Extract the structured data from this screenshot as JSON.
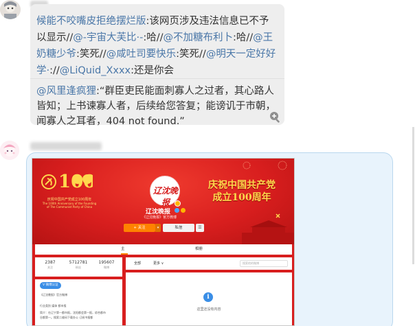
{
  "post1": {
    "repost": [
      {
        "t": "候能不咬嘴皮拒绝摆烂版",
        "m": true
      },
      {
        "t": ":该网页涉及违法信息已不予以显示//",
        "m": false
      },
      {
        "t": "@-宇宙大芙比·-",
        "m": true
      },
      {
        "t": ":哈//",
        "m": false
      },
      {
        "t": "@不加糖布利卜",
        "m": true
      },
      {
        "t": ":哈//",
        "m": false
      },
      {
        "t": "@王奶糖少爷",
        "m": true
      },
      {
        "t": ":笑死//",
        "m": false
      },
      {
        "t": "@咸吐司要快乐",
        "m": true
      },
      {
        "t": ":笑死//",
        "m": false
      },
      {
        "t": "@明天一定好好学·",
        "m": true
      },
      {
        "t": "://",
        "m": false
      },
      {
        "t": "@LiQuid_Xxxx",
        "m": true
      },
      {
        "t": ":还是你会",
        "m": false
      }
    ],
    "original_author": "@风里逢疯狸",
    "original_text": ":“群臣吏民能面刺寡人之过者，其心路人皆知；上书谏寡人者，后续给您答复；能谤讥于市朝，闻寡人之耳者，404 not found.”",
    "zoom_icon": "zoom-in-icon"
  },
  "weibo": {
    "badge_number": "100",
    "badge_years": [
      "1921",
      "2021"
    ],
    "badge_caption_cn": "庆祝中国共产党成立100周年",
    "badge_caption_en": "The 100th Anniversary of the Founding of The Communist Party of China",
    "slogan_line1": "庆祝中国共产党",
    "slogan_line2": "成立100周年",
    "logo_text": "辽沈晚报",
    "profile_name": "辽沈晚报",
    "profile_desc": "《辽沈晚报》官方微博",
    "follow_label": "+ 关注",
    "follow_drop": "▾",
    "message_label": "私信",
    "more_label": "☰",
    "tab_home": "主页",
    "tab_album": "相册",
    "stats": [
      {
        "n": "2387",
        "l": "关注"
      },
      {
        "n": "5712781",
        "l": "粉丝"
      },
      {
        "n": "195607",
        "l": "微博"
      }
    ],
    "verify_tag": "V 微博认证",
    "info_lines": [
      "《辽沈晚报》官方微博",
      "行业类别 媒体 都市报",
      "简介：在辽宁第一都市报，沈阳都会第一报，综合都市",
      "谷都第一。搜索二维码下载办公 订阅书报都"
    ],
    "feed_all": "全部",
    "feed_more": "更多 ∨",
    "search_placeholder": "搜索他的微博",
    "empty_text": "这里还没有内容"
  }
}
